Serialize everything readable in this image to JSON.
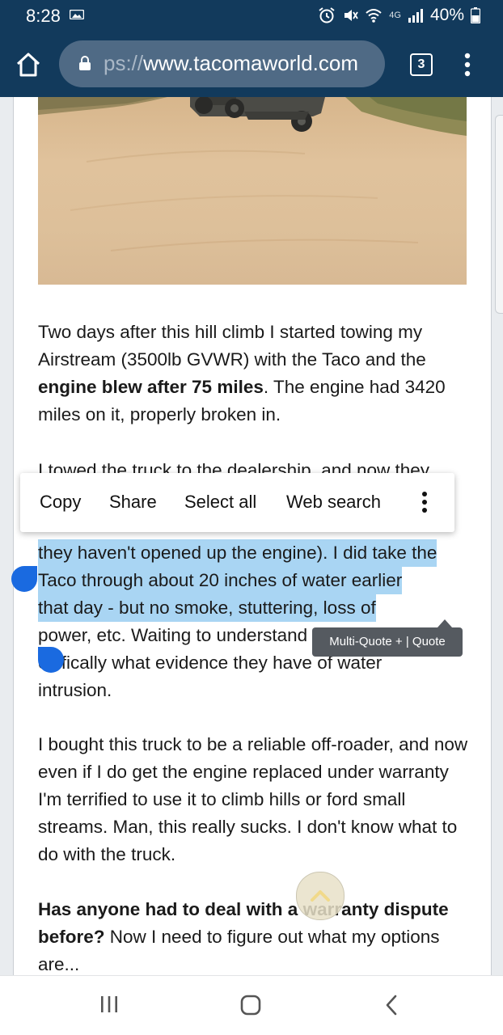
{
  "status_bar": {
    "time": "8:28",
    "battery_percent": "40%",
    "network": "4G"
  },
  "browser": {
    "url_prefix": "ps://",
    "url_domain": "www.tacomaworld.com",
    "tab_count": "3"
  },
  "post": {
    "para1_a": "Two days after this hill climb I started towing my Airstream (3500lb GVWR) with the Taco and the ",
    "para1_bold": "engine blew after 75 miles",
    "para1_b": ". The engine had 3420 miles on it, properly broken in.",
    "para2_line1": "I towed the truck to the dealership, and now they",
    "para2_line3": "they haven't opened up the engine). I did take the",
    "para2_line4": "Taco through about 20 inches of water earlier",
    "para2_line5": "that day - but no smoke, stuttering, loss of",
    "para2_line6_a": "power, etc. Waiting to understand more",
    "para2_line7": "ecifically what evidence they have of water",
    "para2_line8": "intrusion.",
    "para3": "I bought this truck to be a reliable off-roader, and now even if I do get the engine replaced under warranty I'm terrified to use it to climb hills or ford small streams. Man, this really sucks. I don't know what to do with the truck.",
    "para4_bold": "Has anyone had to deal with a warranty dispute before?",
    "para4_rest": " Now I need to figure out what my options are..."
  },
  "context_menu": {
    "copy": "Copy",
    "share": "Share",
    "select_all": "Select all",
    "web_search": "Web search"
  },
  "multi_quote": {
    "label": "Multi-Quote + | Quote"
  },
  "colors": {
    "header": "#123a5c",
    "url_pill": "#4f6a85",
    "selection": "#a9d5f3",
    "selection_handle": "#1a6ae0"
  }
}
